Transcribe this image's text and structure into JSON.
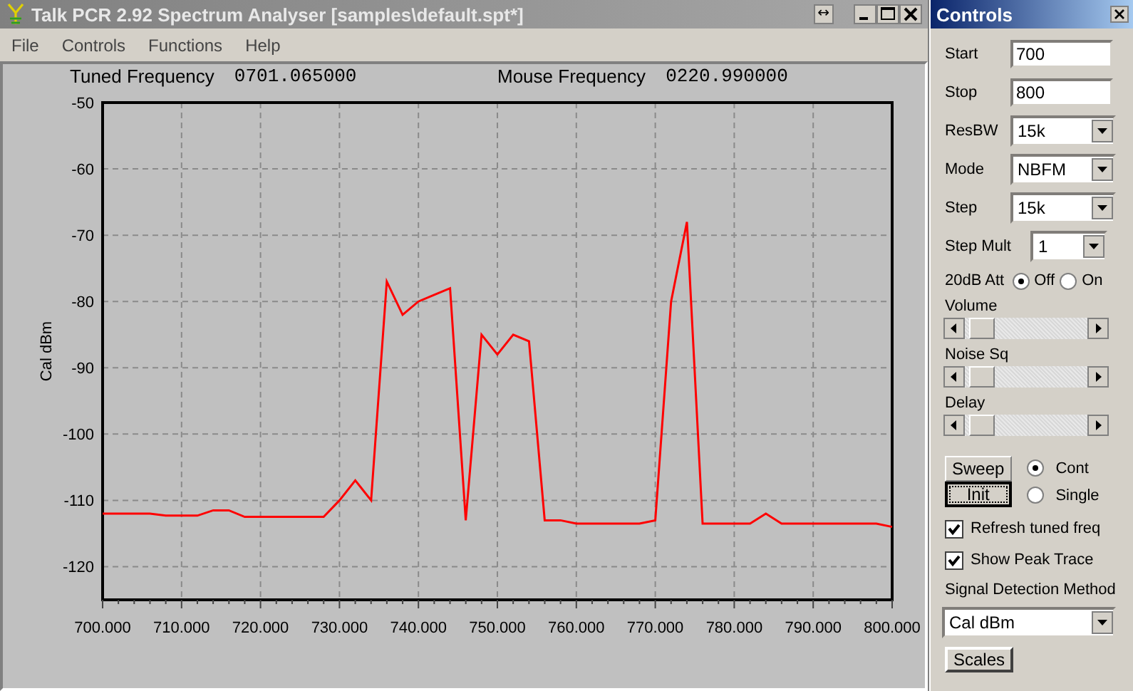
{
  "window": {
    "title": "Talk PCR 2.92 Spectrum Analyser [samples\\default.spt*]",
    "resize_glyph": "↔"
  },
  "menu": [
    "File",
    "Controls",
    "Functions",
    "Help"
  ],
  "readouts": [
    {
      "label": "Tuned Frequency",
      "value": "0701.065000"
    },
    {
      "label": "Mouse Frequency",
      "value": "0220.990000"
    }
  ],
  "chart_data": {
    "type": "line",
    "grid": true,
    "ylabel": "Cal dBm",
    "xlim": [
      700,
      800
    ],
    "ylim": [
      -125,
      -50
    ],
    "xticks": [
      {
        "value": 700,
        "label": "700.000"
      },
      {
        "value": 710,
        "label": "710.000"
      },
      {
        "value": 720,
        "label": "720.000"
      },
      {
        "value": 730,
        "label": "730.000"
      },
      {
        "value": 740,
        "label": "740.000"
      },
      {
        "value": 750,
        "label": "750.000"
      },
      {
        "value": 760,
        "label": "760.000"
      },
      {
        "value": 770,
        "label": "770.000"
      },
      {
        "value": 780,
        "label": "780.000"
      },
      {
        "value": 790,
        "label": "790.000"
      },
      {
        "value": 800,
        "label": "800.000"
      }
    ],
    "yticks": [
      -50,
      -60,
      -70,
      -80,
      -90,
      -100,
      -110,
      -120
    ],
    "x": [
      700,
      702,
      704,
      706,
      708,
      710,
      712,
      714,
      716,
      718,
      720,
      722,
      724,
      726,
      728,
      730,
      732,
      734,
      736,
      738,
      740,
      742,
      744,
      746,
      748,
      750,
      752,
      754,
      756,
      758,
      760,
      762,
      764,
      766,
      768,
      770,
      772,
      774,
      776,
      778,
      780,
      782,
      784,
      786,
      788,
      790,
      792,
      794,
      796,
      798,
      800
    ],
    "series": [
      {
        "color": "#ff0000",
        "values": [
          -112,
          -112,
          -112,
          -112,
          -112.3,
          -112.3,
          -112.3,
          -111.5,
          -111.5,
          -112.5,
          -112.5,
          -112.5,
          -112.5,
          -112.5,
          -112.5,
          -110,
          -107,
          -110,
          -77,
          -82,
          -80,
          -79,
          -78,
          -113,
          -85,
          -88,
          -85,
          -86,
          -113,
          -113,
          -113.5,
          -113.5,
          -113.5,
          -113.5,
          -113.5,
          -113,
          -80,
          -68,
          -113.5,
          -113.5,
          -113.5,
          -113.5,
          -112,
          -113.5,
          -113.5,
          -113.5,
          -113.5,
          -113.5,
          -113.5,
          -113.5,
          -114
        ]
      }
    ]
  },
  "controls": {
    "title": "Controls",
    "fields": [
      {
        "label": "Start",
        "value": "700"
      },
      {
        "label": "Stop",
        "value": "800"
      }
    ],
    "dropdowns": [
      {
        "label": "ResBW",
        "value": "15k"
      },
      {
        "label": "Mode",
        "value": "NBFM"
      },
      {
        "label": "Step",
        "value": "15k"
      },
      {
        "label": "Step Mult",
        "value": "1"
      }
    ],
    "attenuator": {
      "label": "20dB Att",
      "options": [
        {
          "label": "Off",
          "selected": true
        },
        {
          "label": "On",
          "selected": false
        }
      ]
    },
    "sliders": [
      {
        "label": "Volume",
        "level": 0.04
      },
      {
        "label": "Noise Sq",
        "level": 0.04
      },
      {
        "label": "Delay",
        "level": 0.04
      }
    ],
    "sweep_button": "Sweep",
    "init_button": "Init",
    "sweep_modes": [
      {
        "label": "Cont",
        "selected": true
      },
      {
        "label": "Single",
        "selected": false
      }
    ],
    "checkboxes": [
      {
        "label": "Refresh tuned freq",
        "checked": true
      },
      {
        "label": "Show Peak Trace",
        "checked": true
      }
    ],
    "detection": {
      "label": "Signal Detection Method",
      "value": "Cal dBm"
    },
    "scales_button": "Scales"
  }
}
